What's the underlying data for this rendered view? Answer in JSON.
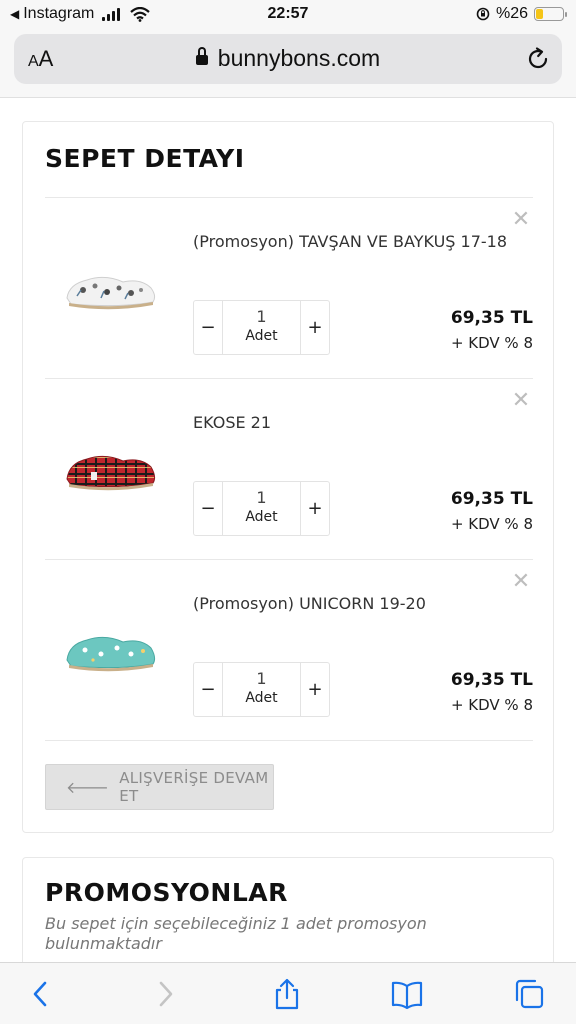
{
  "status_bar": {
    "back_app": "Instagram",
    "time": "22:57",
    "battery_text": "%26",
    "battery_level": 0.26
  },
  "browser": {
    "text_size_label": "AA",
    "url": "bunnybons.com"
  },
  "cart": {
    "title": "SEPET DETAYI",
    "items": [
      {
        "name": "(Promosyon) TAVŞAN VE BAYKUŞ 17-18",
        "quantity": "1",
        "unit": "Adet",
        "price": "69,35 TL",
        "vat": "+ KDV % 8",
        "image": "white-patterned-baby-shoe"
      },
      {
        "name": "EKOSE 21",
        "quantity": "1",
        "unit": "Adet",
        "price": "69,35 TL",
        "vat": "+ KDV % 8",
        "image": "red-plaid-baby-shoe"
      },
      {
        "name": "(Promosyon) UNICORN 19-20",
        "quantity": "1",
        "unit": "Adet",
        "price": "69,35 TL",
        "vat": "+ KDV % 8",
        "image": "turquoise-unicorn-baby-shoe"
      }
    ],
    "continue_label": "ALIŞVERİŞE DEVAM ET"
  },
  "promotions": {
    "title": "PROMOSYONLAR",
    "description": "Bu sepet için seçebileceğiniz 1 adet promosyon bulunmaktadır"
  },
  "colors": {
    "accent": "#1a73e8",
    "battery": "#f5c518"
  }
}
